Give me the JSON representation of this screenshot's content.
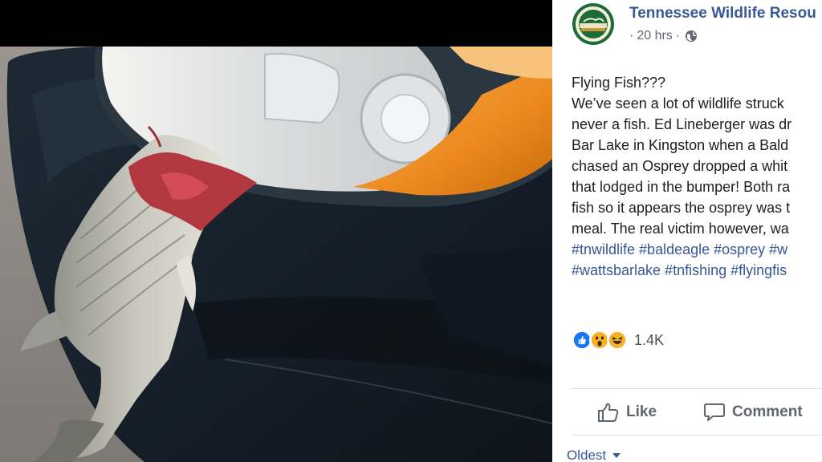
{
  "post": {
    "page_name": "Tennessee Wildlife Resou",
    "time": "20 hrs",
    "separator": "·",
    "visibility_icon": "globe-icon",
    "avatar_lettering": [
      "TENNESSEE",
      "WILDLIFE RESOURCES",
      "AGENCY"
    ],
    "text_lines": [
      "Flying Fish???",
      "We’ve seen a lot of wildlife struck",
      "never a fish. Ed Lineberger was dr",
      "Bar Lake in Kingston when a Bald",
      "chased an Osprey dropped a whit",
      "that lodged in the bumper! Both ra",
      "fish so it appears the osprey was t",
      "meal. The real victim however, wa"
    ],
    "hashtag_lines": [
      "#tnwildlife #baldeagle #osprey #w",
      "#wattsbarlake #tnfishing #flyingfis"
    ]
  },
  "reactions": {
    "icons": [
      "like-reaction-icon",
      "wow-reaction-icon",
      "haha-reaction-icon"
    ],
    "count": "1.4K"
  },
  "actions": {
    "like_label": "Like",
    "comment_label": "Comment"
  },
  "comments": {
    "sort_label": "Oldest"
  },
  "colors": {
    "link_blue": "#385898",
    "text": "#1c1e21",
    "muted": "#616770",
    "avatar_green": "#1e6b3a"
  }
}
